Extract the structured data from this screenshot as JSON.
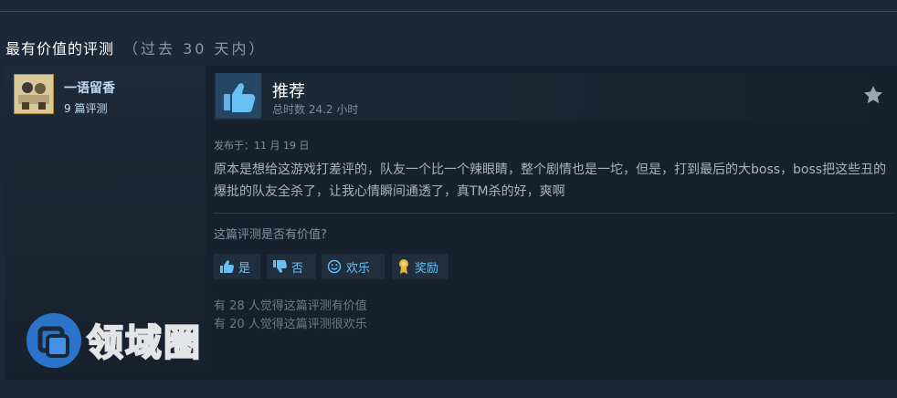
{
  "section": {
    "title": "最有价值的评测",
    "range": "（过去 30 天内）"
  },
  "author": {
    "name": "一语留香",
    "reviews": "9 篇评测"
  },
  "review": {
    "verdict": "推荐",
    "hours": "总时数 24.2 小时",
    "posted": "发布于：11 月 19 日",
    "text": "原本是想给这游戏打差评的，队友一个比一个辣眼睛，整个剧情也是一坨，但是，打到最后的大boss，boss把这些丑的爆批的队友全杀了，让我心情瞬间通透了，真TM杀的好，爽啊"
  },
  "feedback": {
    "question": "这篇评测是否有价值?",
    "yes": "是",
    "no": "否",
    "funny": "欢乐",
    "award": "奖励",
    "helpful_stat": "有 28 人觉得这篇评测有价值",
    "funny_stat": "有 20 人觉得这篇评测很欢乐"
  },
  "watermark": {
    "text": "领域圈"
  },
  "colors": {
    "background": "#1b2838",
    "card": "#17212d",
    "accent": "#66c0f4",
    "thumb_box": "#2a4a66"
  },
  "icons": [
    "thumbs-up-icon",
    "star-icon",
    "thumbs-down-icon",
    "smiley-icon",
    "award-ribbon-icon"
  ]
}
